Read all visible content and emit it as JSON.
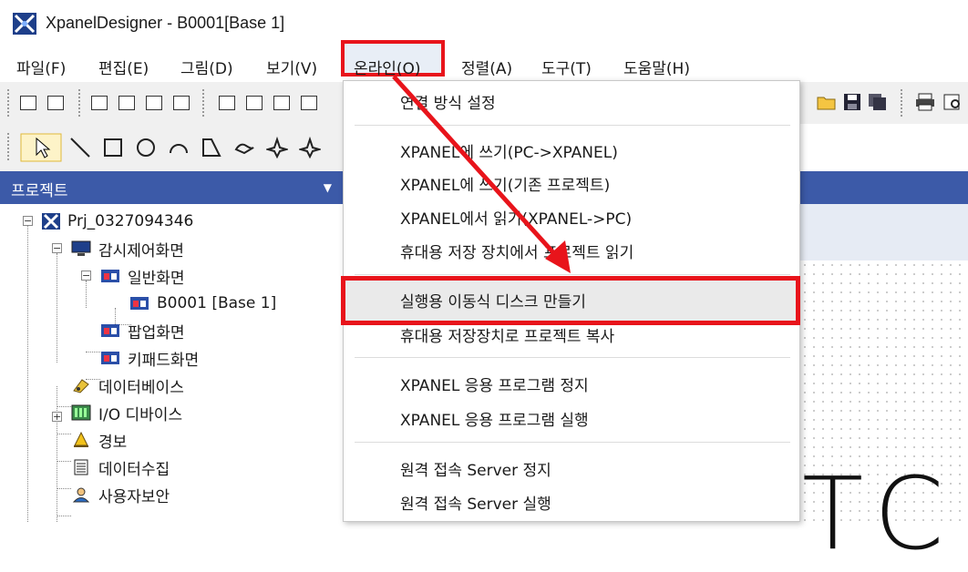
{
  "window": {
    "title": "XpanelDesigner - B0001[Base 1]"
  },
  "menubar": {
    "items": [
      {
        "label": "파일(F)"
      },
      {
        "label": "편집(E)"
      },
      {
        "label": "그림(D)"
      },
      {
        "label": "보기(V)"
      },
      {
        "label": "온라인(O)"
      },
      {
        "label": "정렬(A)"
      },
      {
        "label": "도구(T)"
      },
      {
        "label": "도움말(H)"
      }
    ],
    "active": "온라인(O)"
  },
  "project_panel": {
    "title": "프로젝트",
    "tree": [
      {
        "label": "Prj_0327094346",
        "icon": "project-x-icon"
      },
      {
        "label": "감시제어화면",
        "icon": "monitor-icon"
      },
      {
        "label": "일반화면",
        "icon": "screen-window-icon"
      },
      {
        "label": "B0001 [Base 1]",
        "icon": "screen-window-icon"
      },
      {
        "label": "팝업화면",
        "icon": "screen-window-icon"
      },
      {
        "label": "키패드화면",
        "icon": "screen-window-icon"
      },
      {
        "label": "데이터베이스",
        "icon": "database-icon"
      },
      {
        "label": "I/O 디바이스",
        "icon": "io-device-icon"
      },
      {
        "label": "경보",
        "icon": "alarm-bell-icon"
      },
      {
        "label": "데이터수집",
        "icon": "data-collection-icon"
      },
      {
        "label": "사용자보안",
        "icon": "user-security-icon"
      }
    ]
  },
  "online_menu": {
    "items": [
      {
        "label": "연결 방식 설정"
      },
      {
        "label": "XPANEL에 쓰기(PC->XPANEL)"
      },
      {
        "label": "XPANEL에 쓰기(기존 프로젝트)"
      },
      {
        "label": "XPANEL에서 읽기(XPANEL->PC)"
      },
      {
        "label": "휴대용 저장 장치에서 프로젝트 읽기"
      },
      {
        "label": "실행용 이동식 디스크 만들기"
      },
      {
        "label": "휴대용 저장장치로 프로젝트 복사"
      },
      {
        "label": "XPANEL 응용 프로그램 정지"
      },
      {
        "label": "XPANEL 응용 프로그램 실행"
      },
      {
        "label": "원격 접속 Server 정지"
      },
      {
        "label": "원격 접속 Server 실행"
      }
    ],
    "highlighted": "실행용 이동식 디스크 만들기"
  },
  "canvas": {
    "visible_text": "TC"
  },
  "colors": {
    "annotation_red": "#e8141b",
    "panel_header_blue": "#3c5aa8",
    "menu_hover": "#eaeaea"
  }
}
